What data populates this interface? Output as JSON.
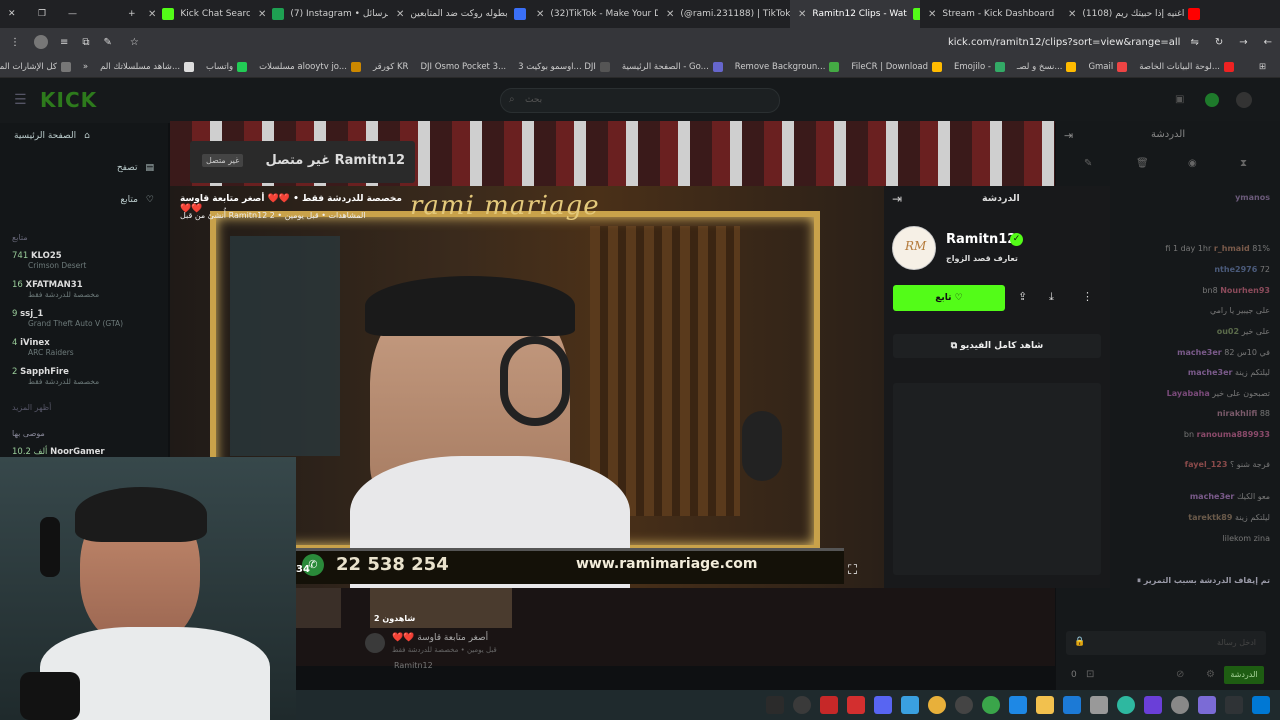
{
  "browser": {
    "tabs": [
      {
        "label": "",
        "color": "#ffffff"
      },
      {
        "label": "Kick Chat Search",
        "color": "#53fc18"
      },
      {
        "label": "(7) Instagram • الرسائل",
        "color": "#d6249f"
      },
      {
        "label": "بطوله روكت ضد المتابعين",
        "color": "#3a6ff7"
      },
      {
        "label": "(32)TikTok - Make Your D",
        "color": "#ffffff"
      },
      {
        "label": "(@rami.231188) | TikTok",
        "color": "#ffffff"
      },
      {
        "label": "Ramitn12 Clips - Wat",
        "color": "#53fc18"
      },
      {
        "label": "Stream - Kick Dashboard",
        "color": "#53fc18"
      },
      {
        "label": "(1108) اغنيه إذا حبيتك ريم",
        "color": "#ff0000"
      }
    ],
    "url": "kick.com/ramitn12/clips?sort=view&range=all",
    "bookmarks": [
      {
        "label": "لوحة البيانات الخاصة...",
        "color": "#e22"
      },
      {
        "label": "Gmail",
        "color": "#e44"
      },
      {
        "label": "نسخ و لصـ...",
        "color": "#fb0"
      },
      {
        "label": "Emojilo -",
        "color": "#5a5"
      },
      {
        "label": "FileCR | Download",
        "color": "#fb0"
      },
      {
        "label": "Remove Backgroun...",
        "color": "#4a4"
      },
      {
        "label": "الصفحة الرئيسية - Go...",
        "color": "#88f"
      },
      {
        "label": "اوسمو بوكيت 3... DJI",
        "color": "#ccc"
      },
      {
        "label": "DJI Osmo Pocket 3...",
        "color": "#ccc"
      },
      {
        "label": "كورقر KR",
        "color": "#fb0"
      },
      {
        "label": "مسلسلات alooytv jo...",
        "color": "#ccc"
      },
      {
        "label": "واتساب",
        "color": "#2c5"
      },
      {
        "label": "شاهد مسلسلاتك الم...",
        "color": "#eee"
      },
      {
        "label": "كل الإشارات المرجعية",
        "color": "#ccc"
      }
    ]
  },
  "kick": {
    "logo": "KICK",
    "search_placeholder": "بحث",
    "nav": [
      "الصفحة الرئيسية",
      "تصفح",
      "متابع"
    ],
    "following_header": "متابع",
    "channels": [
      {
        "count": "741",
        "name": "KLO25",
        "game": "Crimson Desert"
      },
      {
        "count": "16",
        "name": "XFATMAN31",
        "game": "مخصصة للدردشة فقط"
      },
      {
        "count": "9",
        "name": "ssj_1",
        "game": "Grand Theft Auto V (GTA)"
      },
      {
        "count": "4",
        "name": "iVinex",
        "game": "ARC Raiders"
      },
      {
        "count": "2",
        "name": "SapphFire",
        "game": "مخصصة للدردشة فقط"
      }
    ],
    "show_more": "أظهر المزيد",
    "recommended": "موصى بها",
    "recommended_first": {
      "count": "10.2 ألف",
      "name": "NoorGamer"
    },
    "offline_title": "غير متصل Ramitn12",
    "offline_badge": "غير متصل",
    "chat_title": "الدردشة",
    "chat_send": "الدردشة",
    "chat_count": "0",
    "chat_input_placeholder": "ادخل رسالة"
  },
  "clip": {
    "title": "مخصصة للدردشة فقط • ❤️❤️ أصغر متابعة قاوسة ❤️❤️",
    "meta": "المشاهدات • قبل يومين • 2 Ramitn12 أُنشئ من قبل",
    "overlay_brand": "rami mariage",
    "phone": "22 538 254",
    "website": "www.ramimariage.com",
    "channel_name": "Ramitn12",
    "channel_desc": "تعارف قصد الزواج",
    "follow_label": "تابع",
    "watch_full": "شاهد كامل الفيديو",
    "chat_header": "الدردشة",
    "side_number": "34"
  },
  "thumbs": [
    {
      "title": "أصغر متابعة قاوسة ❤️❤️",
      "meta": "قبل يومين • مخصصة للدردشة فقط",
      "author": "Ramitn12",
      "views": "شاهدون 2"
    }
  ],
  "chat_messages": [
    {
      "user": "ymanos",
      "text": ""
    },
    {
      "user": "r_hmaid",
      "text": "81% fi 1 day 1hr"
    },
    {
      "user": "nthe2976",
      "text": "72"
    },
    {
      "user": "Nourhen93",
      "text": "bn8"
    },
    {
      "user": "",
      "text": "على جيبير يا رامي"
    },
    {
      "user": "ou02",
      "text": "على خير"
    },
    {
      "user": "mache3er",
      "text": "في 10س 82"
    },
    {
      "user": "mache3er",
      "text": "ليلتكم زينة"
    },
    {
      "user": "Layabaha",
      "text": "تصبحون على خير"
    },
    {
      "user": "nirakhlifi",
      "text": "88"
    },
    {
      "user": "ranouma889933",
      "text": "bn"
    },
    {
      "user": "fayel_123",
      "text": "فرجة شنو ؟"
    },
    {
      "user": "mache3er",
      "text": "معو الكيك"
    },
    {
      "user": "tarektk89",
      "text": "ليلتكم زينة"
    },
    {
      "user": "",
      "text": "lilekom zina"
    },
    {
      "user": "",
      "text": "تم إيقاف الدردشة بسبب التمرير"
    }
  ]
}
